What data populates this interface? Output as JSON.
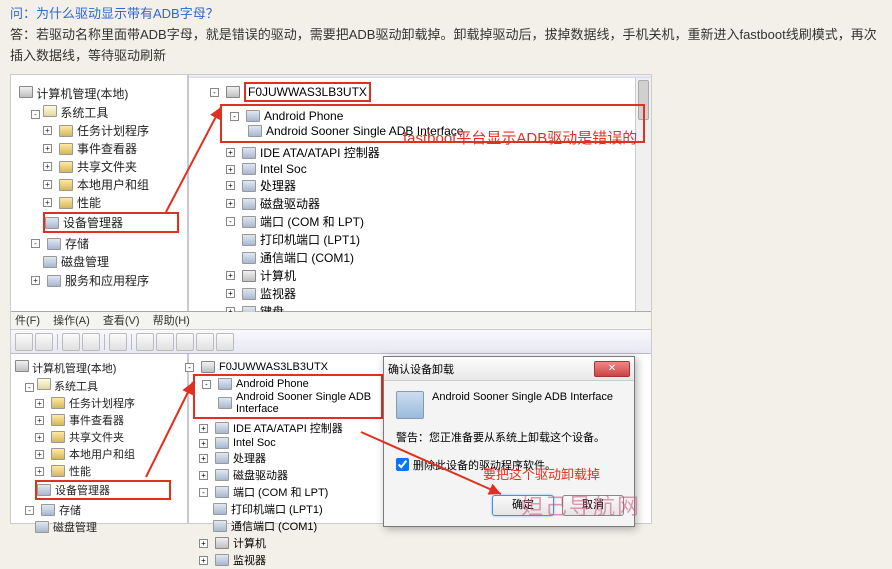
{
  "qa": {
    "question": "问：为什么驱动显示带有ADB字母？",
    "answer": "答：若驱动名称里面带ADB字母，就是错误的驱动，需要把ADB驱动卸载掉。卸载掉驱动后，拔掉数据线，手机关机，重新进入fastboot线刷模式，再次插入数据线，等待驱动刷新"
  },
  "top": {
    "left": {
      "root": "计算机管理(本地)",
      "systools": "系统工具",
      "task": "任务计划程序",
      "event": "事件查看器",
      "share": "共享文件夹",
      "users": "本地用户和组",
      "perf": "性能",
      "devmgr": "设备管理器",
      "storage": "存储",
      "disk": "磁盘管理",
      "services": "服务和应用程序"
    },
    "right": {
      "root": "F0JUWWAS3LB3UTX",
      "android": "Android Phone",
      "adb": "Android Sooner Single ADB Interface",
      "ide": "IDE ATA/ATAPI 控制器",
      "intel": "Intel Soc",
      "cpu": "处理器",
      "diskdrv": "磁盘驱动器",
      "ports": "端口 (COM 和 LPT)",
      "lpt": "打印机端口 (LPT1)",
      "com": "通信端口 (COM1)",
      "computer": "计算机",
      "monitor": "监视器",
      "keyboard": "键盘"
    },
    "note": "fastboot平台显示ADB驱动是错误的"
  },
  "bot": {
    "menu": {
      "file": "件(F)",
      "action": "操作(A)",
      "view": "查看(V)",
      "help": "帮助(H)"
    },
    "left": {
      "root": "计算机管理(本地)",
      "systools": "系统工具",
      "task": "任务计划程序",
      "event": "事件查看器",
      "share": "共享文件夹",
      "users": "本地用户和组",
      "perf": "性能",
      "devmgr": "设备管理器",
      "storage": "存储",
      "disk": "磁盘管理"
    },
    "right": {
      "root": "F0JUWWAS3LB3UTX",
      "android": "Android Phone",
      "adb": "Android Sooner Single ADB Interface",
      "ide": "IDE ATA/ATAPI 控制器",
      "intel": "Intel Soc",
      "cpu": "处理器",
      "diskdrv": "磁盘驱动器",
      "ports": "端口 (COM 和 LPT)",
      "lpt": "打印机端口 (LPT1)",
      "com": "通信端口 (COM1)",
      "computer": "计算机",
      "monitor": "监视器"
    },
    "dialog": {
      "title": "确认设备卸载",
      "device": "Android Sooner Single ADB Interface",
      "warn": "警告：您正准备要从系统上卸载这个设备。",
      "check": "删除此设备的驱动程序软件。",
      "ok": "确定",
      "cancel": "取消"
    },
    "note": "要把这个驱动卸载掉"
  },
  "watermark": "妲己导航网"
}
